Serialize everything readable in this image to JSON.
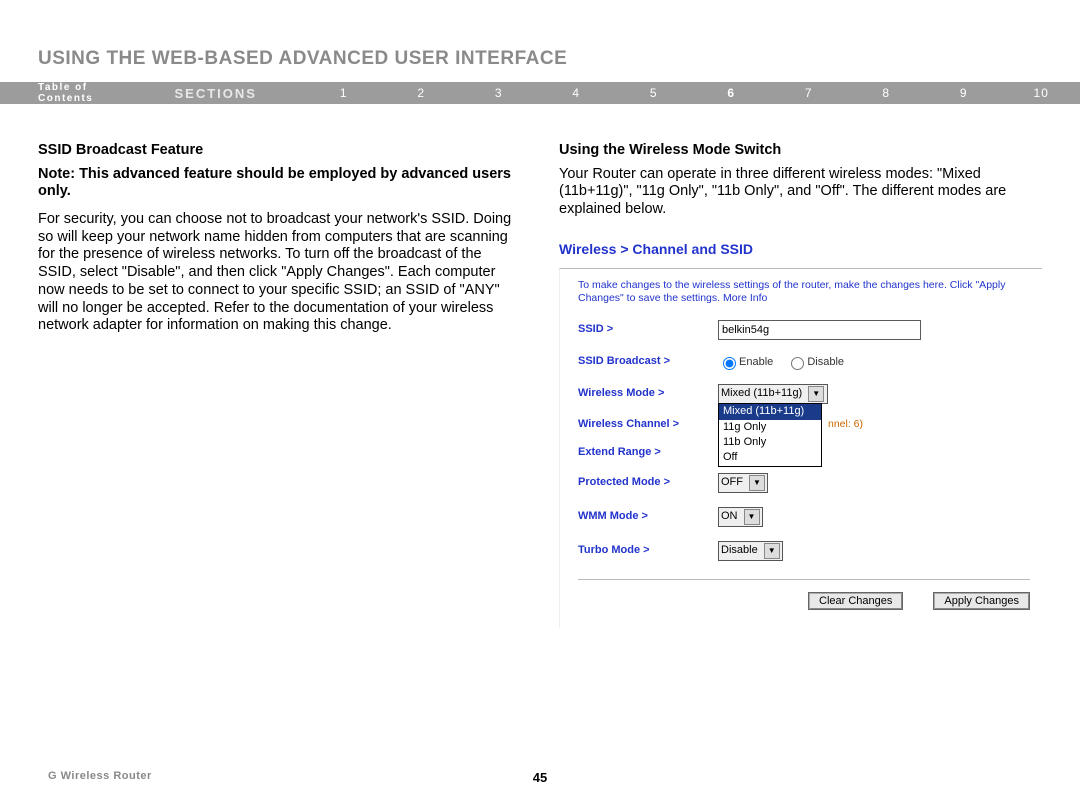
{
  "title": "USING THE WEB-BASED ADVANCED USER INTERFACE",
  "nav": {
    "toc": "Table of Contents",
    "sections_label": "SECTIONS",
    "numbers": [
      "1",
      "2",
      "3",
      "4",
      "5",
      "6",
      "7",
      "8",
      "9",
      "10"
    ],
    "active": "6"
  },
  "left": {
    "heading": "SSID Broadcast Feature",
    "note": "Note: This advanced feature should be employed by advanced users only.",
    "body": "For security, you can choose not to broadcast your network's SSID. Doing so will keep your network name hidden from computers that are scanning for the presence of wireless networks. To turn off the broadcast of the SSID, select \"Disable\", and then click \"Apply Changes\". Each computer now needs to be set to connect to your specific SSID; an SSID of \"ANY\" will no longer be accepted. Refer to the documentation of your wireless network adapter for information on making this change."
  },
  "right": {
    "heading": "Using the Wireless Mode Switch",
    "body": "Your Router can operate in three different wireless modes: \"Mixed (11b+11g)\", \"11g Only\", \"11b Only\", and \"Off\". The different modes are explained below.",
    "panel_heading": "Wireless > Channel and SSID",
    "helptext": "To make changes to the wireless settings of the router, make the changes here. Click \"Apply Changes\" to save the settings.",
    "moreinfo": "More Info",
    "labels": {
      "ssid": "SSID >",
      "broadcast": "SSID Broadcast >",
      "mode": "Wireless Mode >",
      "channel": "Wireless Channel >",
      "extend": "Extend Range >",
      "protected": "Protected Mode >",
      "wmm": "WMM Mode >",
      "turbo": "Turbo Mode >"
    },
    "values": {
      "ssid": "belkin54g",
      "broadcast_enable": "Enable",
      "broadcast_disable": "Disable",
      "mode_selected": "Mixed (11b+11g)",
      "mode_options": [
        "Mixed (11b+11g)",
        "11g Only",
        "11b Only",
        "Off"
      ],
      "channel_note": "nnel: 6)",
      "protected": "OFF",
      "wmm": "ON",
      "turbo": "Disable"
    },
    "buttons": {
      "clear": "Clear Changes",
      "apply": "Apply Changes"
    }
  },
  "footer": {
    "product": "G Wireless Router",
    "page": "45"
  }
}
